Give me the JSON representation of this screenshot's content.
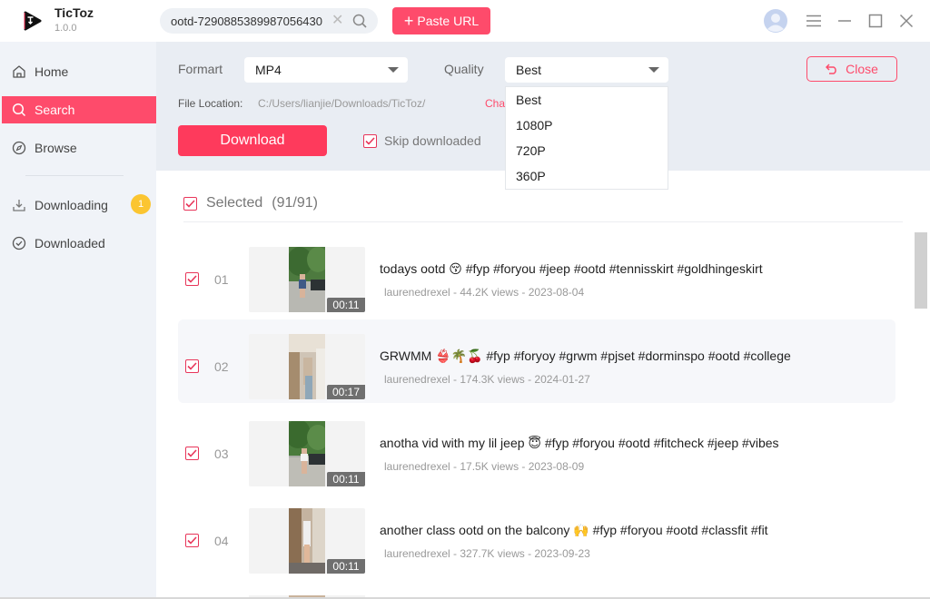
{
  "app": {
    "name": "TicToz",
    "version": "1.0.0",
    "accent_color": "#fe4b6b"
  },
  "titlebar": {
    "search_value": "ootd-7290885389987056430",
    "paste_url_label": "Paste URL",
    "icons": [
      "avatar-icon",
      "menu-icon",
      "minimize-icon",
      "maximize-icon",
      "close-icon"
    ]
  },
  "sidebar": {
    "items": [
      {
        "label": "Home",
        "icon": "home-icon",
        "active": false
      },
      {
        "label": "Search",
        "icon": "search-icon",
        "active": true
      },
      {
        "label": "Browse",
        "icon": "compass-icon",
        "active": false
      },
      {
        "label": "Downloading",
        "icon": "download-tray-icon",
        "active": false,
        "badge": "1"
      },
      {
        "label": "Downloaded",
        "icon": "check-circle-icon",
        "active": false
      }
    ]
  },
  "settings": {
    "format_label": "Formart",
    "format_value": "MP4",
    "quality_label": "Quality",
    "quality_value": "Best",
    "quality_options": [
      "Best",
      "1080P",
      "720P",
      "360P"
    ],
    "file_location_label": "File Location:",
    "file_location_value": "C:/Users/lianjie/Downloads/TicToz/",
    "change_label": "Change",
    "download_label": "Download",
    "skip_downloaded_label": "Skip downloaded",
    "skip_downloaded_checked": true,
    "close_label": "Close"
  },
  "selection": {
    "label": "Selected",
    "count": "(91/91)",
    "checked": true
  },
  "videos": [
    {
      "index": "01",
      "title": "todays ootd 😚 #fyp #foryou #jeep #ootd #tennisskirt #goldhingeskirt",
      "meta": "laurenedrexel - 44.2K views - 2023-08-04",
      "duration": "00:11",
      "checked": true
    },
    {
      "index": "02",
      "title": "GRWMM 👙🌴🍒 #fyp #foryoy #grwm #pjset #dorminspo #ootd #college",
      "meta": "laurenedrexel - 174.3K views - 2024-01-27",
      "duration": "00:17",
      "checked": true
    },
    {
      "index": "03",
      "title": "anotha vid with my lil jeep 😇 #fyp #foryou #ootd #fitcheck #jeep #vibes",
      "meta": "laurenedrexel - 17.5K views - 2023-08-09",
      "duration": "00:11",
      "checked": true
    },
    {
      "index": "04",
      "title": "another class ootd on the balcony 🙌 #fyp #foryou #ootd #classfit #fit",
      "meta": "laurenedrexel - 327.7K views - 2023-09-23",
      "duration": "00:11",
      "checked": true
    }
  ]
}
